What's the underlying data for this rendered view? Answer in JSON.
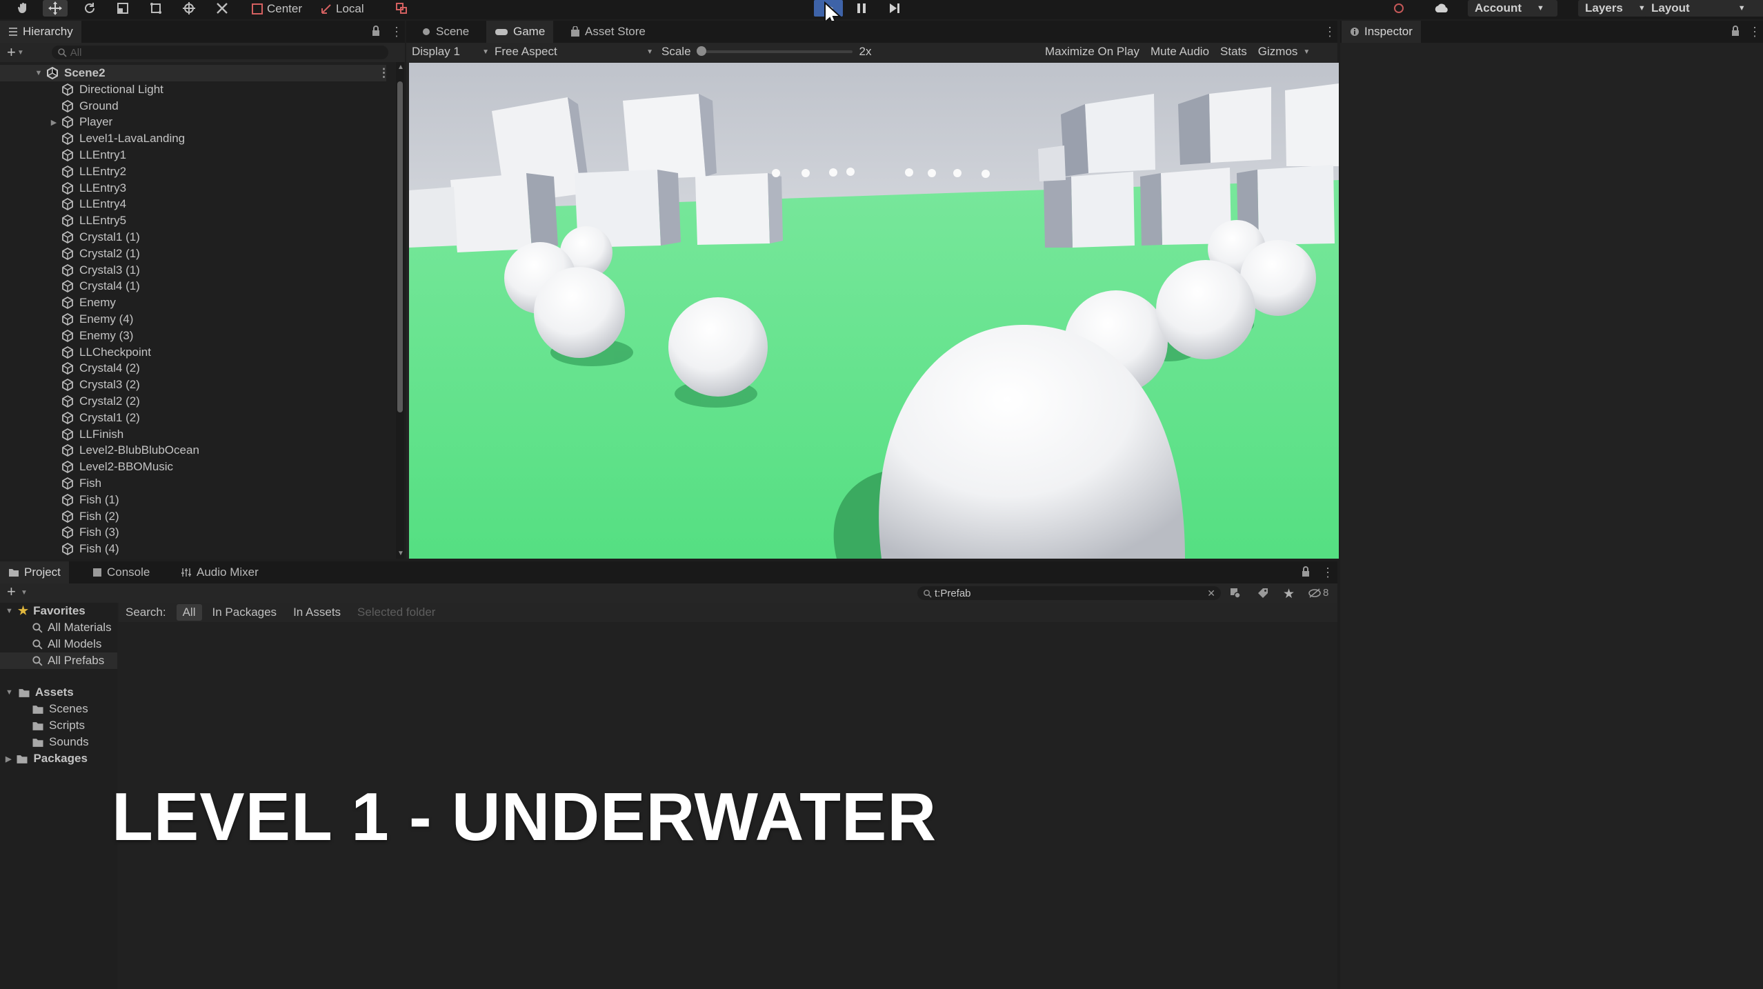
{
  "toolbar": {
    "tools": [
      "hand-tool-icon",
      "move-tool-icon",
      "rotate-tool-icon",
      "scale-tool-icon",
      "rect-tool-icon",
      "transform-tool-icon",
      "custom-tool-icon"
    ],
    "pivot_label": "Center",
    "space_label": "Local",
    "account_label": "Account",
    "layers_label": "Layers",
    "layout_label": "Layout",
    "play_active": true
  },
  "hierarchy": {
    "tab_label": "Hierarchy",
    "search_placeholder": "All",
    "scene_name": "Scene2",
    "items": [
      "Directional Light",
      "Ground",
      "Player",
      "Level1-LavaLanding",
      "LLEntry1",
      "LLEntry2",
      "LLEntry3",
      "LLEntry4",
      "LLEntry5",
      "Crystal1 (1)",
      "Crystal2 (1)",
      "Crystal3 (1)",
      "Crystal4 (1)",
      "Enemy",
      "Enemy (4)",
      "Enemy (3)",
      "LLCheckpoint",
      "Crystal4 (2)",
      "Crystal3 (2)",
      "Crystal2 (2)",
      "Crystal1 (2)",
      "LLFinish",
      "Level2-BlubBlubOcean",
      "Level2-BBOMusic",
      "Fish",
      "Fish (1)",
      "Fish (2)",
      "Fish (3)",
      "Fish (4)"
    ]
  },
  "game_panel": {
    "tabs": [
      "Scene",
      "Game",
      "Asset Store"
    ],
    "selected_tab": "Game",
    "display": "Display 1",
    "aspect": "Free Aspect",
    "scale_label": "Scale",
    "scale_value": "2x",
    "right_controls": [
      "Maximize On Play",
      "Mute Audio",
      "Stats",
      "Gizmos"
    ]
  },
  "inspector": {
    "tab_label": "Inspector"
  },
  "project": {
    "tabs": [
      "Project",
      "Console",
      "Audio Mixer"
    ],
    "search_value": "t:Prefab",
    "search_label": "Search:",
    "filters": [
      "All",
      "In Packages",
      "In Assets",
      "Selected folder"
    ],
    "hidden_count": "8",
    "favorites_label": "Favorites",
    "favorites": [
      "All Materials",
      "All Models",
      "All Prefabs"
    ],
    "assets_label": "Assets",
    "folders": [
      "Scenes",
      "Scripts",
      "Sounds"
    ],
    "packages_label": "Packages"
  },
  "overlay": {
    "title": "LEVEL 1 - UNDERWATER"
  },
  "colors": {
    "accent": "#3e63a8",
    "sky_top": "#c9cdd4",
    "ground": "#5ee38a"
  }
}
